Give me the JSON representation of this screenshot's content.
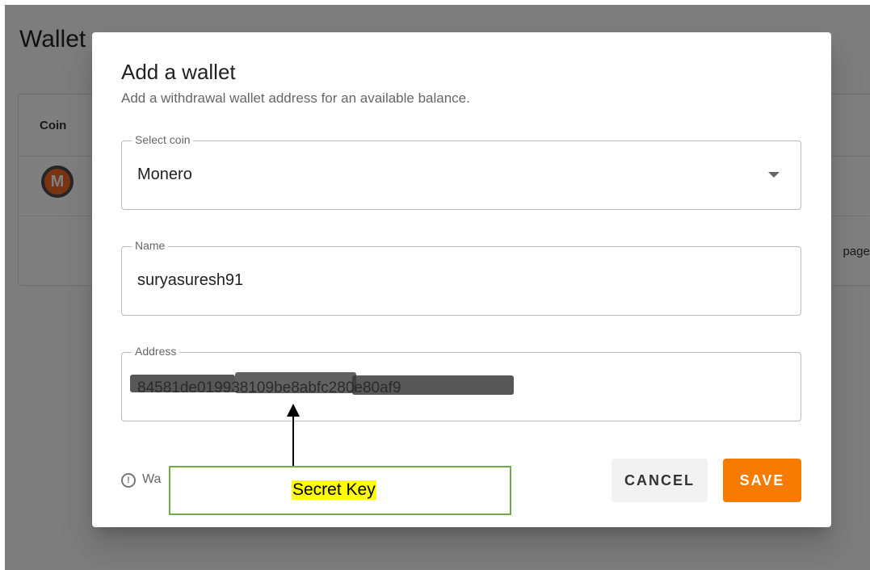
{
  "background": {
    "page_title": "Wallet",
    "column_coin": "Coin",
    "page_label": "page:"
  },
  "dialog": {
    "title": "Add a wallet",
    "subtitle": "Add a withdrawal wallet address for an available balance.",
    "coin_field": {
      "label": "Select coin",
      "value": "Monero"
    },
    "name_field": {
      "label": "Name",
      "value": "suryasuresh91"
    },
    "address_field": {
      "label": "Address",
      "value": "84581de019938109be8abfc280e80af9"
    },
    "note_text": "Wa",
    "cancel_label": "CANCEL",
    "save_label": "SAVE"
  },
  "annotation": {
    "label": "Secret Key"
  },
  "colors": {
    "accent": "#f57c00",
    "monero": "#f26822",
    "annotation_border": "#70ad47",
    "annotation_highlight": "#ffff00"
  }
}
